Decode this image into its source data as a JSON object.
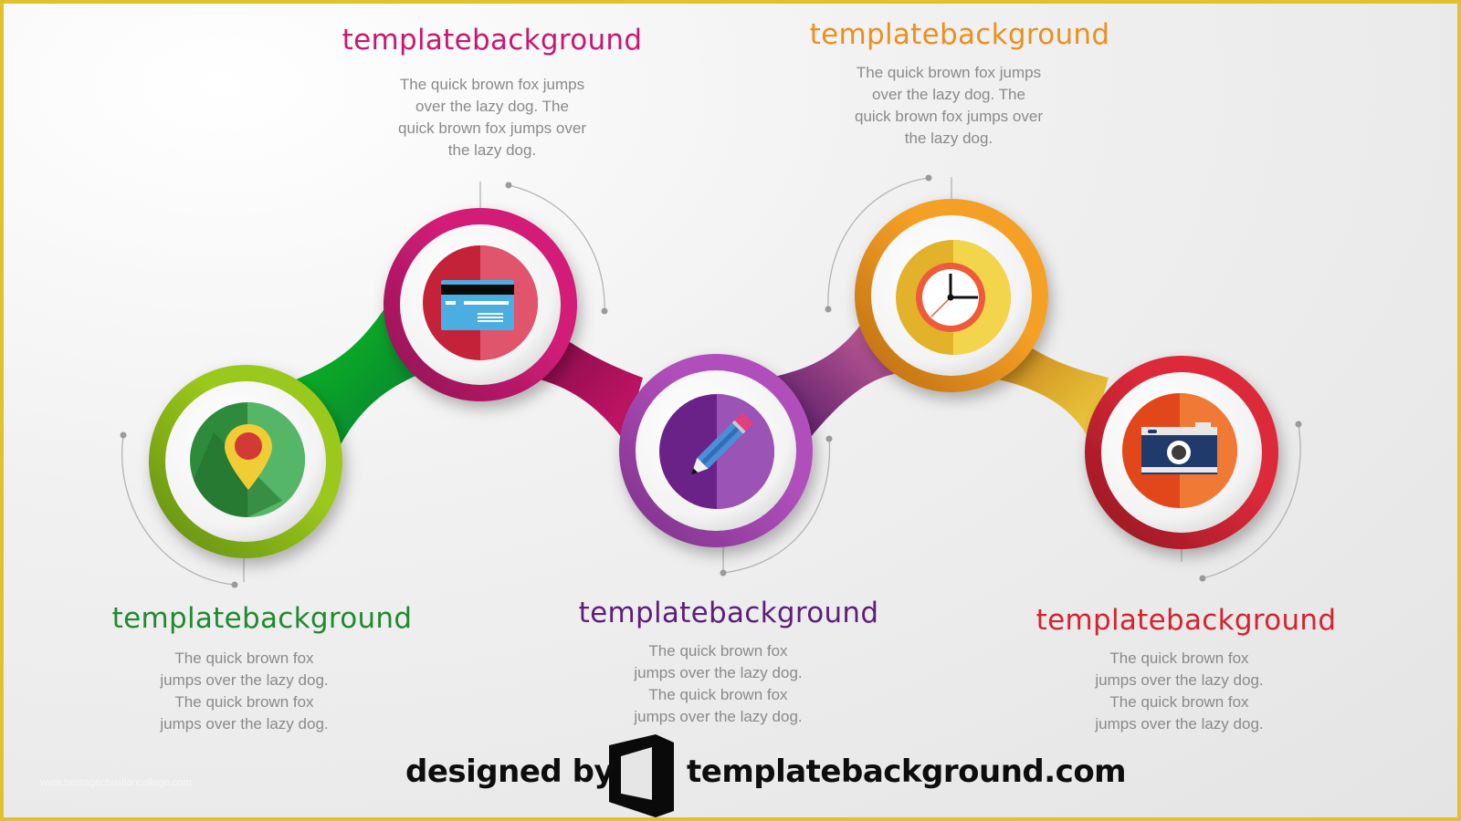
{
  "steps": [
    {
      "title": "templatebackground",
      "color": "#1f8a2e",
      "body": "The quick brown fox jumps over the lazy dog. The quick brown fox jumps over the lazy dog.",
      "icon": "map-pin-icon"
    },
    {
      "title": "templatebackground",
      "color": "#c8176f",
      "body": "The quick brown fox jumps over the lazy dog. The quick brown fox jumps over the lazy dog.",
      "icon": "credit-card-icon"
    },
    {
      "title": "templatebackground",
      "color": "#5c1f7a",
      "body": "The quick brown fox jumps over the lazy dog. The quick brown fox jumps over the lazy dog.",
      "icon": "pencil-icon"
    },
    {
      "title": "templatebackground",
      "color": "#ec8f1c",
      "body": "The quick brown fox jumps over the lazy dog. The quick brown fox jumps over the lazy dog.",
      "icon": "clock-icon"
    },
    {
      "title": "templatebackground",
      "color": "#d4232f",
      "body": "The quick brown fox jumps over the lazy dog. The quick brown fox jumps over the lazy dog.",
      "icon": "camera-icon"
    }
  ],
  "footer": {
    "designed_by": "designed by",
    "site": "templatebackground.com",
    "logo_icon": "office-door-logo-icon"
  },
  "watermark": "www.heritagechristiancollege.com",
  "colors": {
    "frame": "#e0c12e",
    "green_ring": "#8fc21a",
    "magenta_ring": "#c8176f",
    "purple_ring": "#a24bb0",
    "orange_ring": "#f09a22",
    "red_ring": "#d4232f"
  }
}
